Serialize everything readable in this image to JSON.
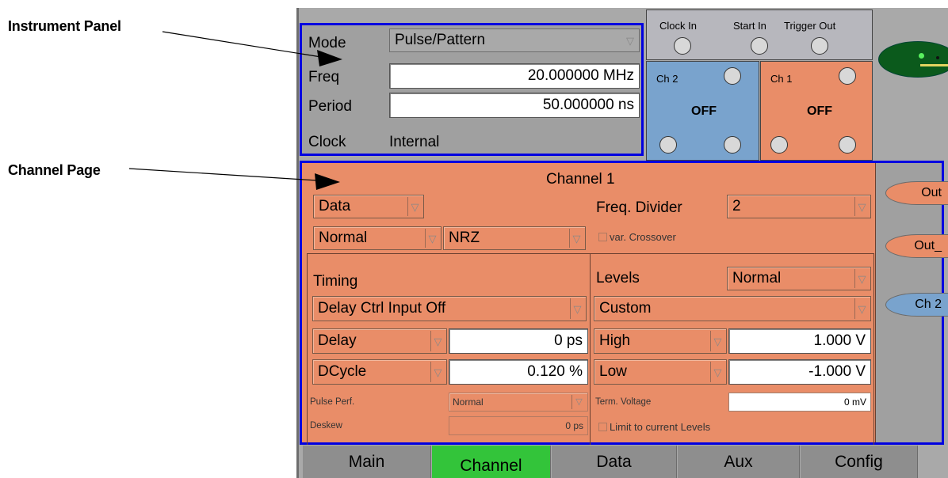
{
  "annotations": {
    "instrument_panel": "Instrument Panel",
    "channel_page": "Channel Page"
  },
  "instrument": {
    "mode_label": "Mode",
    "mode_value": "Pulse/Pattern",
    "freq_label": "Freq",
    "freq_value": "20.000000 MHz",
    "period_label": "Period",
    "period_value": "50.000000 ns",
    "clock_label": "Clock",
    "clock_value": "Internal"
  },
  "connectors": {
    "clock_in": "Clock In",
    "start_in": "Start In",
    "trigger_out": "Trigger Out",
    "ch2_label": "Ch 2",
    "ch2_state": "OFF",
    "ch1_label": "Ch 1",
    "ch1_state": "OFF"
  },
  "channel": {
    "title": "Channel 1",
    "data_select": "Data",
    "normal_select": "Normal",
    "format_select": "NRZ",
    "freq_divider_label": "Freq. Divider",
    "freq_divider_value": "2",
    "var_crossover": "var. Crossover",
    "timing_title": "Timing",
    "delay_ctrl": "Delay Ctrl Input Off",
    "delay_select": "Delay",
    "delay_value": "0 ps",
    "dcycle_select": "DCycle",
    "dcycle_value": "0.120 %",
    "pulse_perf_label": "Pulse Perf.",
    "pulse_perf_value": "Normal",
    "deskew_label": "Deskew",
    "deskew_value": "0 ps",
    "levels_title": "Levels",
    "levels_mode": "Normal",
    "levels_preset": "Custom",
    "high_select": "High",
    "high_value": "1.000 V",
    "low_select": "Low",
    "low_value": "-1.000 V",
    "term_voltage_label": "Term. Voltage",
    "term_voltage_value": "0 mV",
    "limit_levels": "Limit to current Levels"
  },
  "side_buttons": {
    "out": "Out",
    "out_bar": "Out_",
    "ch2": "Ch 2"
  },
  "tabs": [
    "Main",
    "Channel",
    "Data",
    "Aux",
    "Config"
  ],
  "active_tab": "Channel",
  "colors": {
    "channel_orange": "#e98d68",
    "channel_blue": "#79a3cd",
    "active_tab_green": "#33c43a",
    "highlight_border": "#0000e0"
  }
}
